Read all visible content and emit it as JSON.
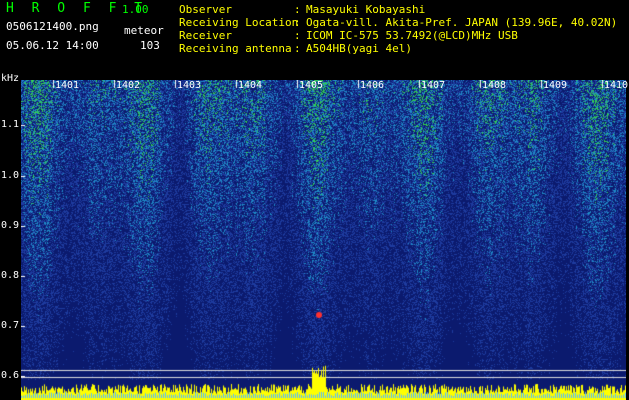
{
  "header": {
    "app_name": "H R O F F T",
    "version": "1.00",
    "file_name": "0506121400.png",
    "datetime": "05.06.12 14:00",
    "event_label": "meteor",
    "event_count": "103"
  },
  "station": {
    "observer_label": "Observer",
    "observer_value": "Masayuki Kobayashi",
    "location_label": "Receiving Location",
    "location_value": "Ogata-vill. Akita-Pref. JAPAN (139.96E, 40.02N)",
    "receiver_label": "Receiver",
    "receiver_value": "ICOM IC-575 53.7492(@LCD)MHz USB",
    "antenna_label": "Receiving antenna",
    "antenna_value": "A504HB(yagi 4el)"
  },
  "plot": {
    "y_unit": "kHz",
    "y_ticks": [
      "1.1",
      "1.0",
      "0.9",
      "0.8",
      "0.7",
      "0.6"
    ],
    "x_ticks": [
      "1401",
      "1402",
      "1403",
      "1404",
      "1405",
      "1406",
      "1407",
      "1408",
      "1409",
      "1410"
    ],
    "colors": {
      "background": "#0b1a6e",
      "noise_low": "#1e3ca0",
      "noise_mid": "#1e8cc8",
      "noise_high": "#32d250",
      "peak": "#ffff00",
      "meteor_echo": "#ff3030",
      "text": "#ffffff",
      "accent": "#00ff00",
      "meta": "#ffff00"
    }
  }
}
